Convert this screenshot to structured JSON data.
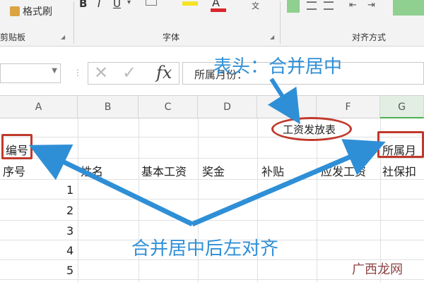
{
  "ribbon": {
    "format_painter_label": "格式刷",
    "clipboard_group": "剪贴板",
    "font_group": "字体",
    "align_group": "对齐方式",
    "bold": "B",
    "italic": "I",
    "underline": "U",
    "fx_small": "文"
  },
  "formula_bar": {
    "fx": "fx",
    "cancel": "✕",
    "confirm": "✓",
    "content": "所属月份："
  },
  "columns": [
    "A",
    "B",
    "C",
    "D",
    "E",
    "F",
    "G"
  ],
  "sheet": {
    "title_cell": "工资发放表",
    "a2": "编号",
    "g2": "所属月",
    "headers": [
      "序号",
      "姓名",
      "基本工资",
      "奖金",
      "补贴",
      "应发工资",
      "社保扣"
    ],
    "row_numbers": [
      "1",
      "2",
      "3",
      "4",
      "5"
    ]
  },
  "annotations": {
    "top": "表头：合并居中",
    "bottom": "合并居中后左对齐"
  },
  "watermark": "广西龙网",
  "colors": {
    "accent": "#2f8fd6",
    "box": "#c0392b",
    "ribbon_bg": "#f3f3f3"
  }
}
